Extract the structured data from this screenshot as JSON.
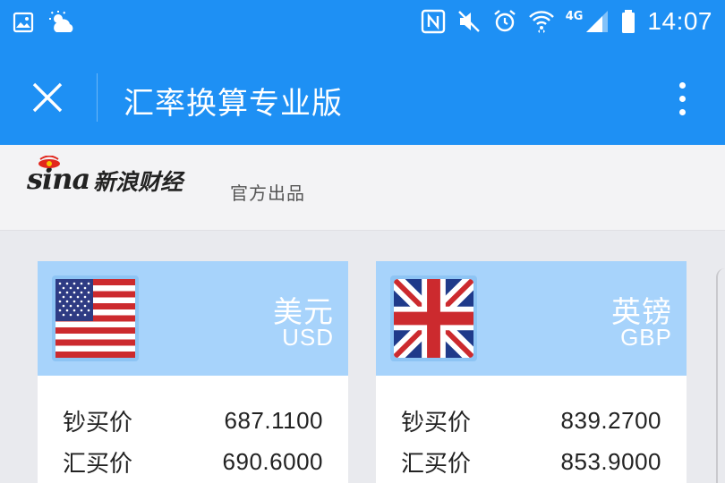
{
  "status_bar": {
    "time": "14:07",
    "network_label": "4G",
    "icons": [
      "gallery-icon",
      "weather-partly-cloudy-icon",
      "nfc-icon",
      "mute-icon",
      "alarm-icon",
      "wifi-icon",
      "signal-icon",
      "battery-icon"
    ]
  },
  "app_bar": {
    "title": "汇率换算专业版",
    "close_icon": "close-icon",
    "more_icon": "more-vertical-icon"
  },
  "brand": {
    "logo_text": "sina",
    "logo_cn": "新浪财经",
    "tagline": "官方出品"
  },
  "cards": [
    {
      "currency_name": "美元",
      "currency_code": "USD",
      "flag": "us-flag-icon",
      "rates": [
        {
          "label": "钞买价",
          "value": "687.1100"
        },
        {
          "label": "汇买价",
          "value": "690.6000"
        }
      ]
    },
    {
      "currency_name": "英镑",
      "currency_code": "GBP",
      "flag": "uk-flag-icon",
      "rates": [
        {
          "label": "钞买价",
          "value": "839.2700"
        },
        {
          "label": "汇买价",
          "value": "853.9000"
        }
      ]
    }
  ],
  "colors": {
    "primary": "#1e90f4",
    "card_header": "#a7d3fb",
    "background": "#e9eaee"
  }
}
